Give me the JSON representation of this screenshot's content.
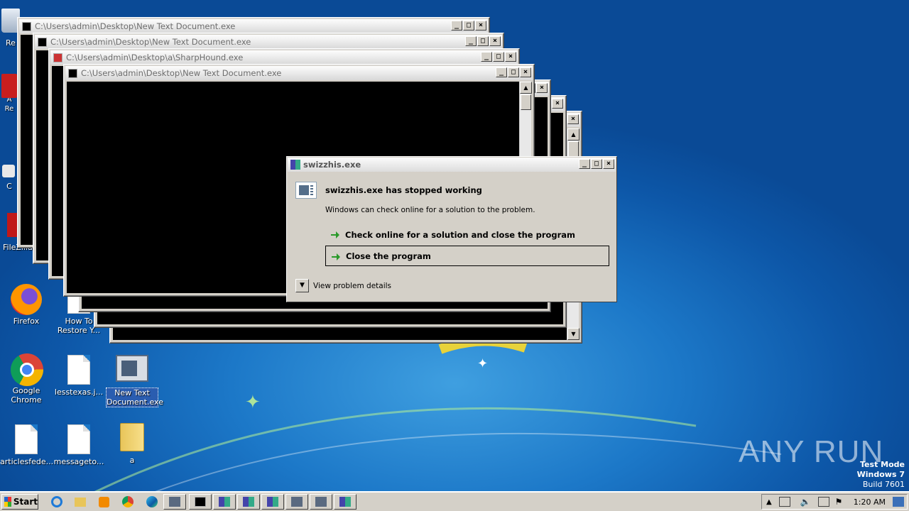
{
  "desktop": {
    "icons": [
      {
        "id": "recycle",
        "label": "Re"
      },
      {
        "id": "acrobat",
        "label": "A\nRe"
      },
      {
        "id": "ccleaner",
        "label": "C"
      },
      {
        "id": "filezilla",
        "label": "FileZilla C"
      },
      {
        "id": "firefox",
        "label": "Firefox"
      },
      {
        "id": "howto",
        "label": "How To\nRestore Y..."
      },
      {
        "id": "chrome",
        "label": "Google\nChrome"
      },
      {
        "id": "lesstexas",
        "label": "lesstexas.j..."
      },
      {
        "id": "newtextdoc",
        "label": "New Text\nDocument.exe"
      },
      {
        "id": "articles",
        "label": "articlesfede..."
      },
      {
        "id": "message",
        "label": "messageto..."
      },
      {
        "id": "folder_a",
        "label": "a"
      }
    ]
  },
  "windows": [
    {
      "title": "C:\\Users\\admin\\Desktop\\New Text Document.exe"
    },
    {
      "title": "C:\\Users\\admin\\Desktop\\New Text Document.exe"
    },
    {
      "title": "C:\\Users\\admin\\Desktop\\a\\SharpHound.exe"
    },
    {
      "title": "C:\\Users\\admin\\Desktop\\New Text Document.exe"
    }
  ],
  "dialog": {
    "title": "swizzhis.exe",
    "heading": "swizzhis.exe has stopped working",
    "message": "Windows can check online for a solution to the problem.",
    "option_check": "Check online for a solution and close the program",
    "option_close": "Close the program",
    "details": "View problem details"
  },
  "taskbar": {
    "start": "Start",
    "clock": "1:20 AM"
  },
  "watermark": "ANY RUN",
  "testmode": {
    "line1": "Test Mode",
    "line2": "Windows 7",
    "line3": "Build 7601"
  },
  "colors": {
    "desktop_bg": "#1c78c8",
    "console_bg": "#000000",
    "dialog_bg": "#d4d0c8",
    "arrow_green": "#2a9a2a"
  }
}
